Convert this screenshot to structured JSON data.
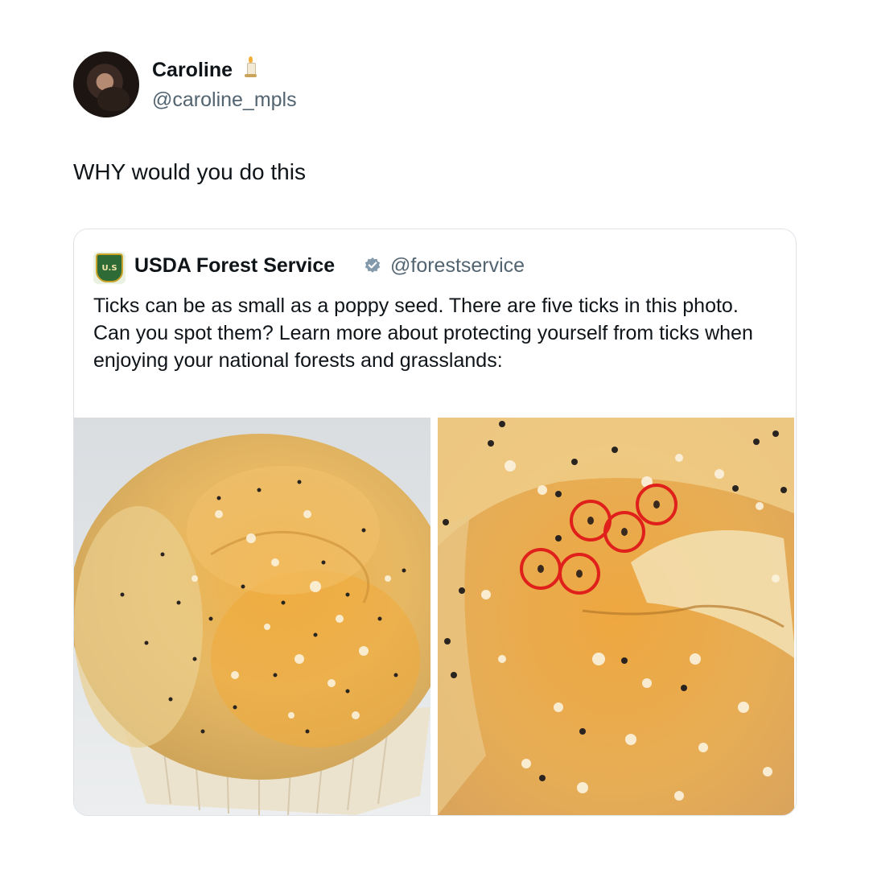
{
  "tweet": {
    "author_name": "Caroline",
    "author_emoji_icon": "candle-icon",
    "author_handle": "@caroline_mpls",
    "text": "WHY would you do this"
  },
  "quoted_tweet": {
    "author_name": "USDA Forest Service",
    "verified_icon": "verified-badge-icon",
    "author_handle": "@forestservice",
    "text": "Ticks can be as small as a poppy seed. There are five ticks in this photo. Can you spot them? Learn more about protecting yourself from ticks when enjoying your national forests and grasslands:",
    "logo_label": "U.S",
    "images": [
      {
        "name": "poppy-seed-muffin-photo"
      },
      {
        "name": "muffin-closeup-with-ticks-circled-photo",
        "highlight_color": "#e0201b",
        "circled_ticks": 5
      }
    ]
  },
  "colors": {
    "text_primary": "#0f1419",
    "text_secondary": "#536471",
    "verified_blue": "#1d9bf0",
    "card_border": "#dfe3e8"
  }
}
